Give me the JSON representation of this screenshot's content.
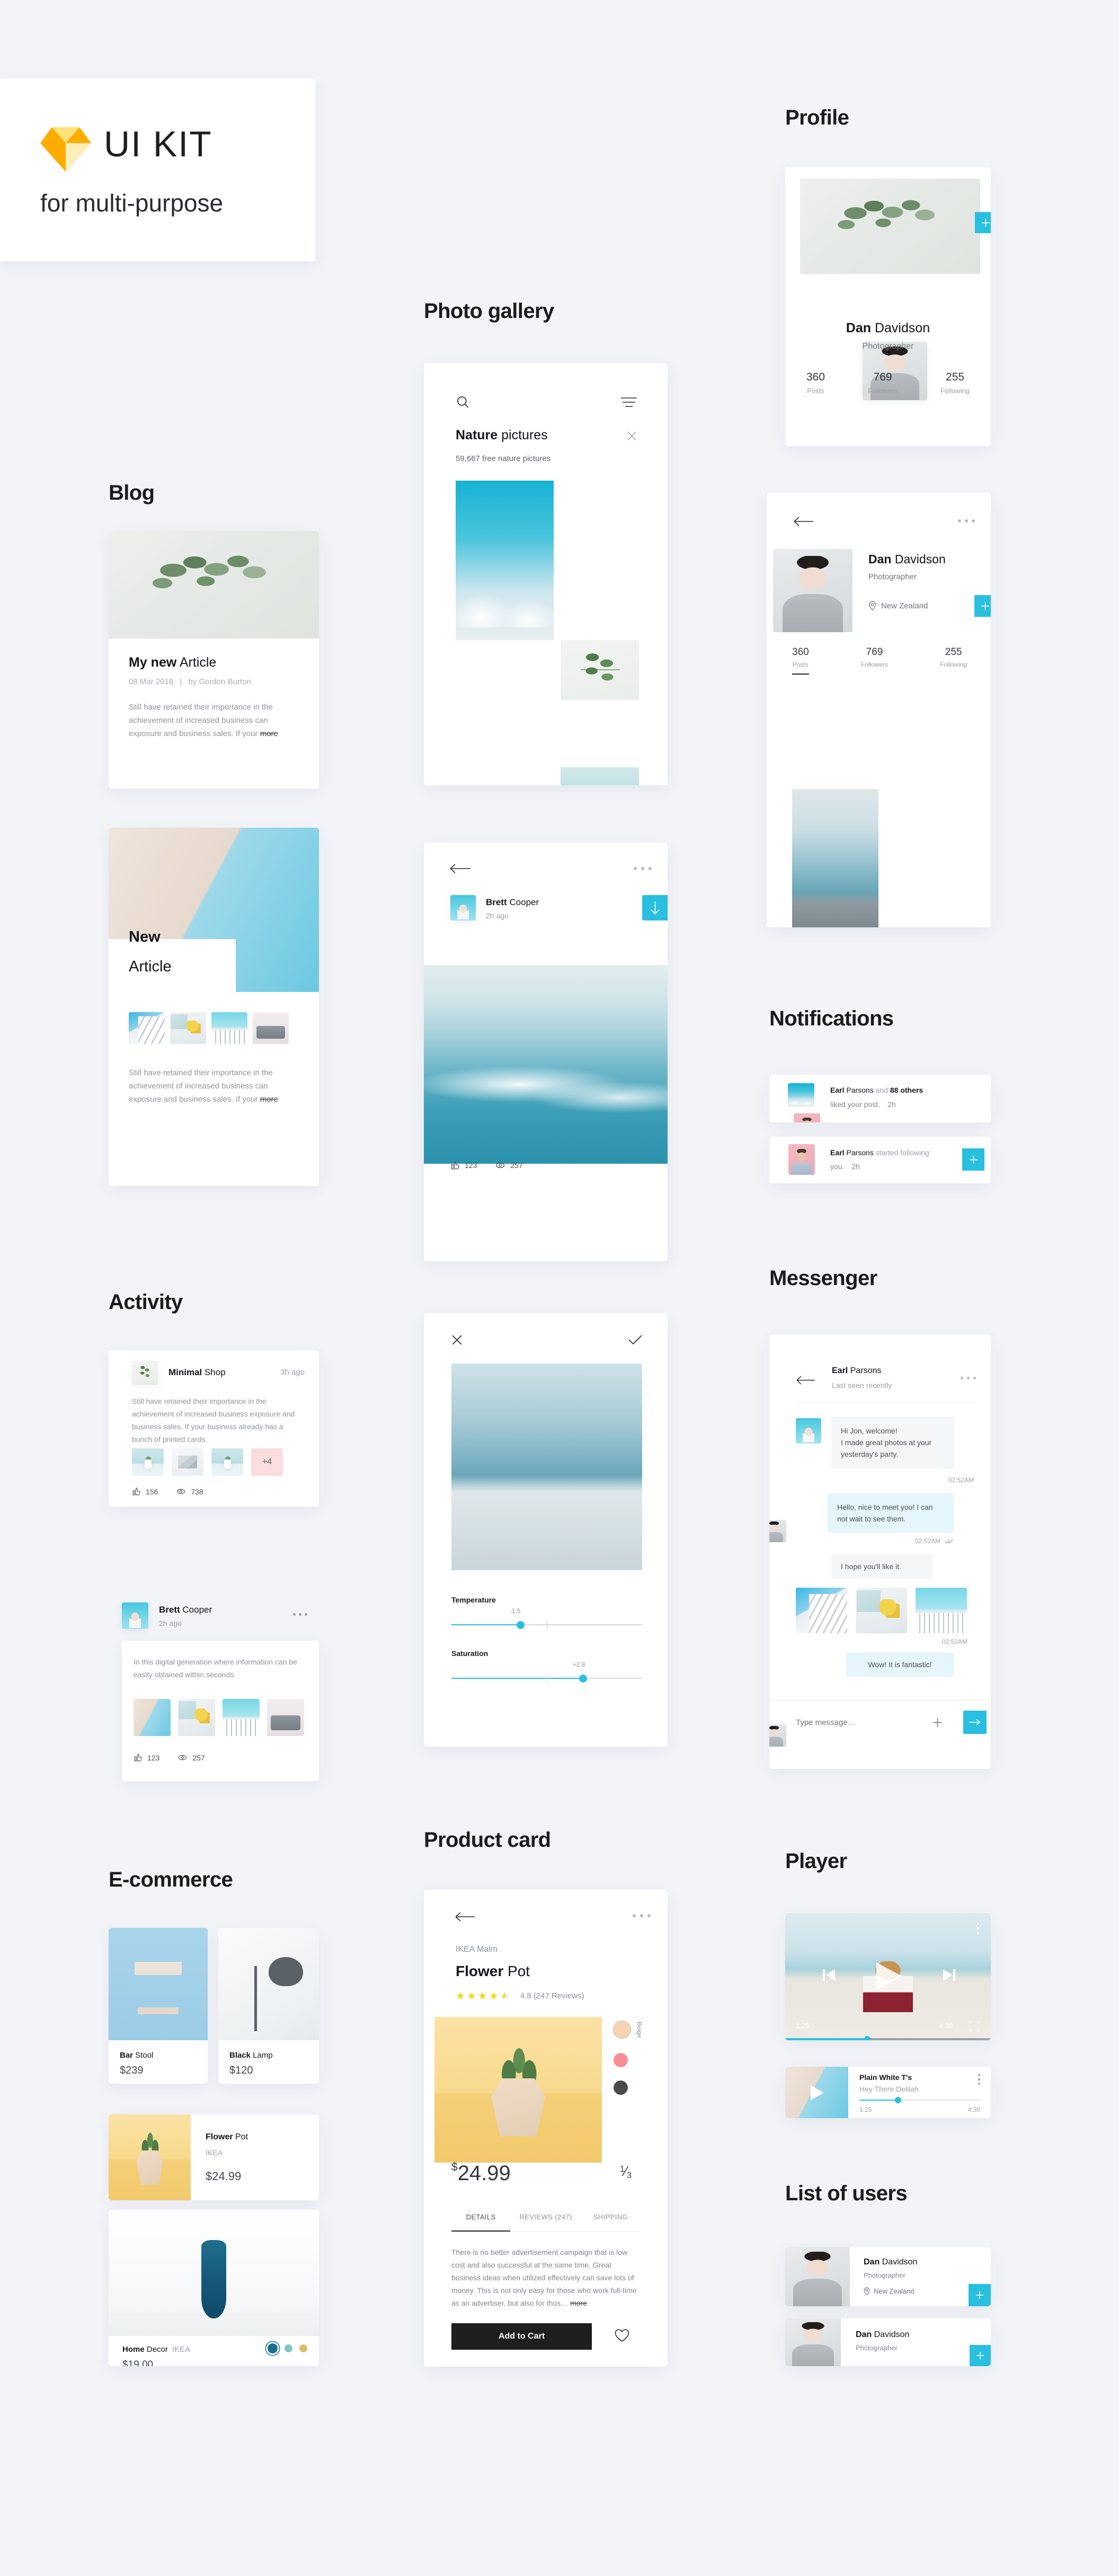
{
  "header": {
    "logo": "sketch-diamond-logo",
    "title": "UI KIT",
    "subtitle": "for multi-purpose"
  },
  "sections": {
    "blog": "Blog",
    "activity": "Activity",
    "ecommerce": "E-commerce",
    "photo_gallery": "Photo gallery",
    "product_card": "Product card",
    "profile": "Profile",
    "notifications": "Notifications",
    "messenger": "Messenger",
    "player": "Player",
    "list_of_users": "List of users"
  },
  "blog": {
    "card1": {
      "title_bold": "My new",
      "title_thin": " Article",
      "meta_date": "08 Mar 2018",
      "meta_sep": "|",
      "meta_author": "by Gordon Burton",
      "excerpt": "Still have retained their importance in the achievement of increased business can exposure and business sales. If your",
      "more": "more"
    },
    "card2": {
      "title_bold": "New",
      "title_thin": "Article",
      "excerpt": "Still have retained their importance in the achievement of increased business can exposure and business sales. If your",
      "more": "more",
      "thumbs": [
        "building-thumb",
        "lemon-tea-thumb",
        "cyan-building-thumb",
        "sofa-thumb"
      ]
    }
  },
  "activity": {
    "post1": {
      "author_bold": "Minimal",
      "author_thin": " Shop",
      "time": "3h ago",
      "body": "Still have retained their importance in the achievement of increased business exposure and business sales. If your business already has a bunch of printed cards.",
      "extra_count": "+4",
      "likes": "156",
      "views": "738",
      "thumbs": [
        "mint-roof-thumb",
        "glass-x-thumb",
        "plant-blue-thumb"
      ]
    },
    "post2": {
      "author_bold": "Brett",
      "author_thin": " Cooper",
      "time": "2h ago",
      "body": "In this digital generation where information can be easily obtained within seconds.",
      "likes": "123",
      "views": "257",
      "thumbs": [
        "wall-sky-thumb",
        "lemon-tea-thumb",
        "cyan-building-thumb",
        "sofa-thumb"
      ]
    }
  },
  "ecommerce": {
    "products": [
      {
        "name_bold": "Bar",
        "name_thin": " Stool",
        "price": "$239",
        "image": "bar-stool-photo"
      },
      {
        "name_bold": "Black",
        "name_thin": " Lamp",
        "price": "$120",
        "image": "black-lamp-photo"
      }
    ],
    "wide_product": {
      "name_bold": "Flower",
      "name_thin": " Pot",
      "brand": "IKEA",
      "price": "$24.99",
      "image": "flower-pot-photo"
    },
    "decor_product": {
      "name_bold": "Home",
      "name_thin": " Decor",
      "brand": "IKEA",
      "price": "$19.00",
      "image": "blue-vase-photo",
      "swatches": [
        "#1b6e8d",
        "#7cc9c0",
        "#d8bd6a"
      ],
      "selected_swatch": 0
    }
  },
  "gallery": {
    "search_placeholder": "",
    "title_bold": "Nature",
    "title_thin": " pictures",
    "subtitle": "59,667 free nature pictures",
    "close_icon": "close-icon",
    "filter_icon": "filter-icon",
    "search_icon": "search-icon",
    "photos": [
      "sky-clouds",
      "green-leaf",
      "mint-pot",
      "sea-horizon",
      "eucalyptus"
    ]
  },
  "photo_post": {
    "author_bold": "Brett",
    "author_thin": " Cooper",
    "time": "2h ago",
    "download_icon": "download-arrow-icon",
    "back_icon": "back-arrow-icon",
    "more_icon": "more-dots-icon",
    "likes": "123",
    "views": "257"
  },
  "photo_editor": {
    "close_icon": "close-icon",
    "check_icon": "check-icon",
    "sliders": [
      {
        "label": "Temperature",
        "value": "-1.5",
        "percent": 36
      },
      {
        "label": "Saturation",
        "value": "+2.8",
        "percent": 69
      }
    ]
  },
  "product_card": {
    "brand": "IKEA Malm",
    "title_bold": "Flower",
    "title_thin": " Pot",
    "rating_value": "4.8 (247 Reviews)",
    "stars": 4.5,
    "price_currency": "$",
    "price_value": "24.99",
    "pager": "1/3",
    "pager_num": "1",
    "pager_den": "3",
    "swatches": [
      {
        "color": "#f8d3b0",
        "label": "Beige",
        "selected": true
      },
      {
        "color": "#f98e92",
        "label": "",
        "selected": false
      },
      {
        "color": "#4a4a4a",
        "label": "",
        "selected": false
      }
    ],
    "tabs": [
      {
        "label": "DETAILS",
        "active": true
      },
      {
        "label": "REVIEWS (247)",
        "active": false
      },
      {
        "label": "SHIPPING",
        "active": false
      }
    ],
    "description": "There is no better advertisement campaign that is low cost and also successful at the same time. Great business ideas when utilized effectively can save lots of money. This is not only easy for those who work full-time as an advertiser, but also for thos…",
    "more": "more",
    "add_to_cart": "Add to Cart",
    "favorite_icon": "heart-icon"
  },
  "profile": {
    "card1": {
      "name_bold": "Dan",
      "name_thin": " Davidson",
      "role": "Photographer",
      "stats": [
        {
          "value": "360",
          "label": "Posts"
        },
        {
          "value": "769",
          "label": "Followers"
        },
        {
          "value": "255",
          "label": "Following"
        }
      ],
      "add_icon": "plus-icon"
    },
    "card2": {
      "name_bold": "Dan",
      "name_thin": " Davidson",
      "role": "Photographer",
      "location": "New Zealand",
      "location_icon": "location-pin-icon",
      "back_icon": "back-arrow-icon",
      "more_icon": "more-dots-icon",
      "add_icon": "plus-icon",
      "stats": [
        {
          "value": "360",
          "label": "Posts"
        },
        {
          "value": "769",
          "label": "Followers"
        },
        {
          "value": "255",
          "label": "Following"
        }
      ]
    }
  },
  "notifications": {
    "items": [
      {
        "name_bold": "Earl",
        "name_thin": " Parsons",
        "mid": " and ",
        "others_bold": "88 others",
        "action": "liked your post.",
        "time": "2h",
        "thumb": "beach-girl-thumb"
      },
      {
        "name_bold": "Earl",
        "name_thin": " Parsons",
        "action_text": "started following you.",
        "time": "2h",
        "add_icon": "plus-icon"
      }
    ]
  },
  "messenger": {
    "name_bold": "Earl",
    "name_thin": " Parsons",
    "status": "Last seen recently",
    "back_icon": "back-arrow-icon",
    "more_icon": "more-dots-icon",
    "messages": [
      {
        "side": "in",
        "text": "Hi Jon, welcome!\nI made great photos at your yesterday's party.",
        "time": "02:52AM"
      },
      {
        "side": "out",
        "text": "Hello, nice to meet you! I can not wait to see them.",
        "time": "02:52AM",
        "read": true
      },
      {
        "side": "in",
        "text": "I hope you'll like it.",
        "time": ""
      },
      {
        "side": "in-images",
        "images": [
          "building-thumb",
          "lemon-tea-thumb",
          "cyan-building-thumb"
        ],
        "time": "02:52AM"
      },
      {
        "side": "out",
        "text": "Wow! It is fantastic!",
        "time": ""
      }
    ],
    "input_placeholder": "Type message…",
    "attach_icon": "plus-icon",
    "send_icon": "send-arrow-icon"
  },
  "player": {
    "video": {
      "current_time": "1:25",
      "total_time": "4:30",
      "progress_percent": 40,
      "prev_icon": "skip-back-icon",
      "play_icon": "play-icon",
      "next_icon": "skip-forward-icon",
      "fullscreen_icon": "fullscreen-icon",
      "more_icon": "more-vertical-icon"
    },
    "track": {
      "artist": "Plain White T's",
      "song": "Hey There Delilah",
      "current_time": "1:25",
      "total_time": "4:30",
      "progress_percent": 32,
      "play_icon": "play-icon",
      "more_icon": "more-vertical-icon"
    }
  },
  "users_list": [
    {
      "name_bold": "Dan",
      "name_thin": " Davidson",
      "role": "Photographer",
      "location": "New Zealand",
      "location_icon": "location-pin-icon",
      "add_icon": "plus-icon"
    },
    {
      "name_bold": "Dan",
      "name_thin": " Davidson",
      "role": "Photographer",
      "add_icon": "plus-icon"
    }
  ],
  "colors": {
    "accent": "#29bfe0",
    "background": "#f2f4f8",
    "text": "#1b1b1f",
    "muted": "#9b9fa6",
    "star": "#f5d813",
    "dark_button": "#1f1f22"
  }
}
